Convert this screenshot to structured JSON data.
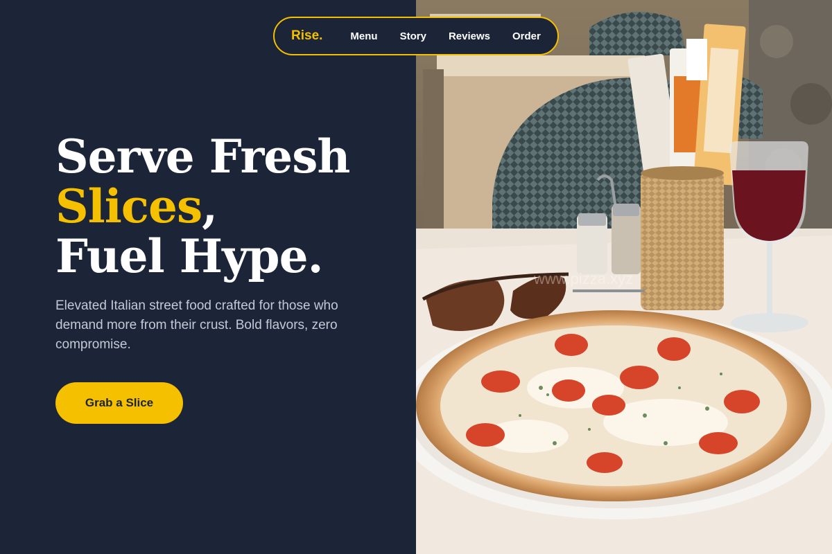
{
  "nav": {
    "brand": "Rise.",
    "links": [
      "Menu",
      "Story",
      "Reviews",
      "Order"
    ]
  },
  "hero": {
    "title_line1": "Serve Fresh",
    "title_accent": "Slices",
    "title_comma": ",",
    "title_line3": "Fuel Hype.",
    "description": "Elevated Italian street food crafted for those who demand more from their crust. Bold flavors, zero compromise.",
    "cta_label": "Grab a Slice"
  },
  "image": {
    "watermark": "www.pizza.xyz"
  },
  "colors": {
    "background": "#1c2438",
    "accent": "#f5c000",
    "text": "#ffffff",
    "muted_text": "#c4c9d6"
  }
}
